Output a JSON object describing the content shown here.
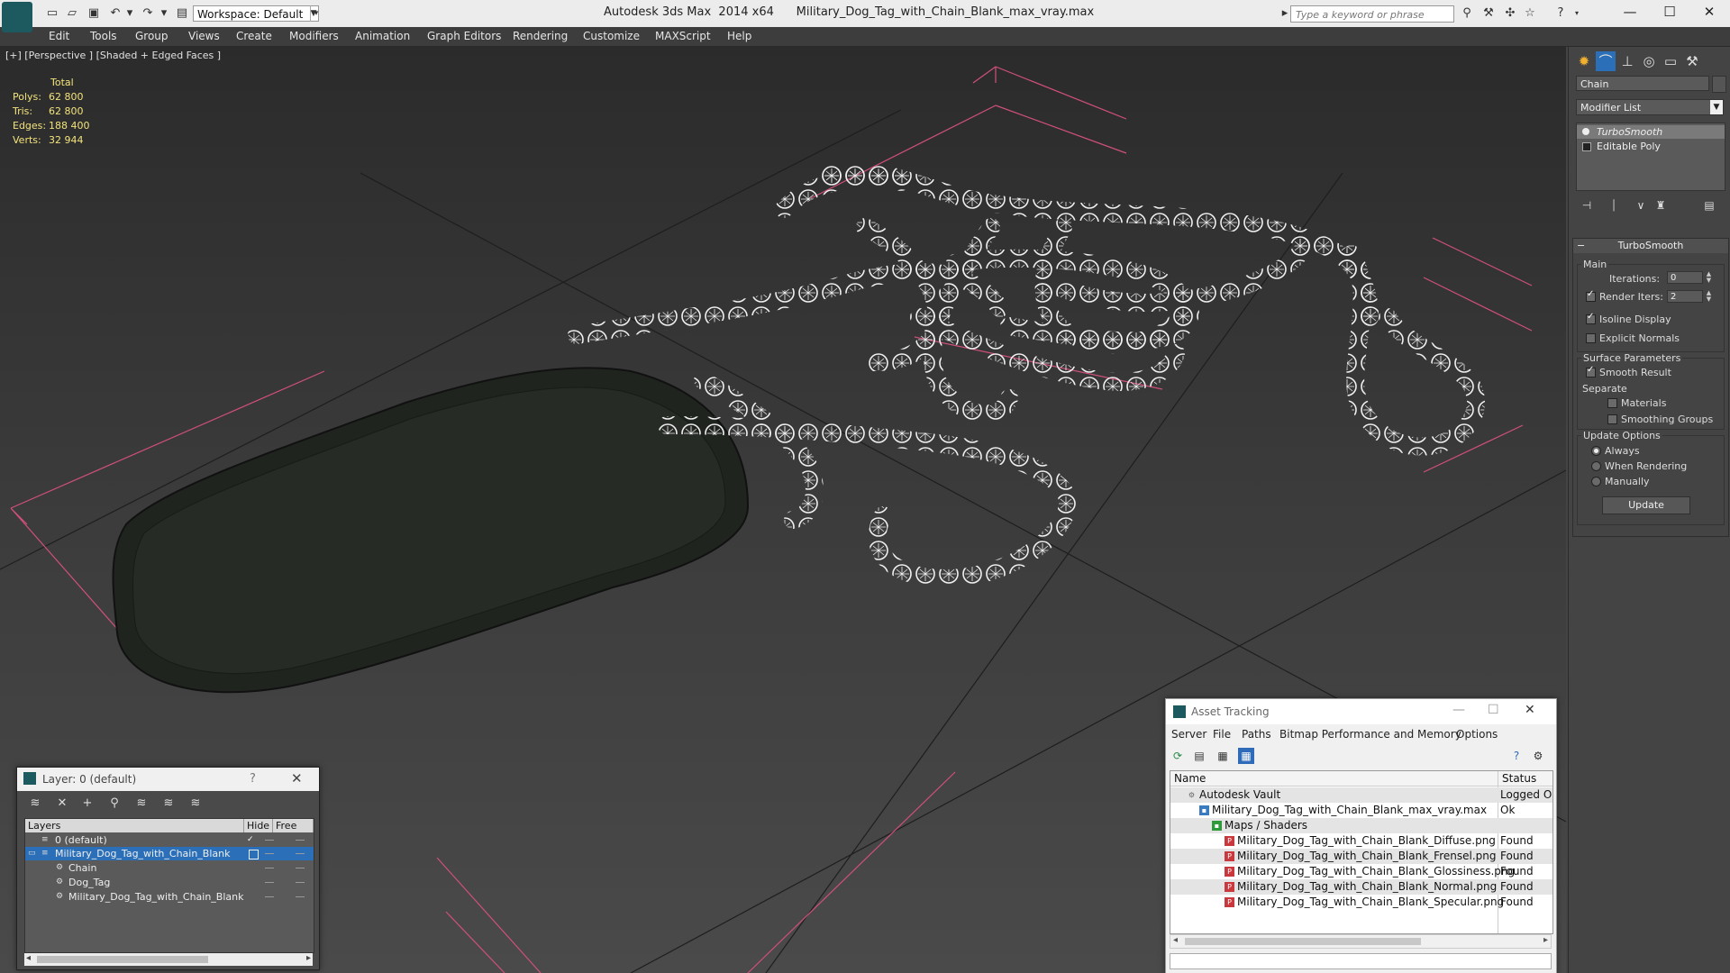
{
  "app": {
    "title": "Autodesk 3ds Max  2014 x64      Military_Dog_Tag_with_Chain_Blank_max_vray.max",
    "workspace": "Workspace: Default",
    "search_placeholder": "Type a keyword or phrase"
  },
  "menu": [
    "Edit",
    "Tools",
    "Group",
    "Views",
    "Create",
    "Modifiers",
    "Animation",
    "Graph Editors",
    "Rendering",
    "Customize",
    "MAXScript",
    "Help"
  ],
  "viewport": {
    "label": "[+] [Perspective ] [Shaded + Edged Faces ]",
    "stats": {
      "header": "Total",
      "rows": [
        {
          "k": "Polys:",
          "v": "62 800"
        },
        {
          "k": "Tris:",
          "v": "62 800"
        },
        {
          "k": "Edges:",
          "v": "188 400"
        },
        {
          "k": "Verts:",
          "v": "32 944"
        }
      ]
    }
  },
  "command_panel": {
    "object_name": "Chain",
    "modifier_list": "Modifier List",
    "stack": [
      "TurboSmooth",
      "Editable Poly"
    ],
    "rollout_title": "TurboSmooth",
    "main_group": "Main",
    "iterations_label": "Iterations:",
    "iterations_value": "0",
    "render_iters_label": "Render Iters:",
    "render_iters_value": "2",
    "isoline_label": "Isoline Display",
    "explicit_label": "Explicit Normals",
    "surface_group": "Surface Parameters",
    "smooth_result_label": "Smooth Result",
    "separate_label": "Separate",
    "materials_label": "Materials",
    "smoothing_groups_label": "Smoothing Groups",
    "update_group": "Update Options",
    "always_label": "Always",
    "when_rendering_label": "When Rendering",
    "manually_label": "Manually",
    "update_button": "Update"
  },
  "layer_window": {
    "title": "Layer: 0 (default)",
    "help": "?",
    "columns": [
      "Layers",
      "Hide",
      "Free"
    ],
    "rows": [
      {
        "name": "0 (default)",
        "indent": 0
      },
      {
        "name": "Military_Dog_Tag_with_Chain_Blank",
        "indent": 0,
        "selected": true
      },
      {
        "name": "Chain",
        "indent": 1
      },
      {
        "name": "Dog_Tag",
        "indent": 1
      },
      {
        "name": "Military_Dog_Tag_with_Chain_Blank",
        "indent": 1
      }
    ]
  },
  "asset_window": {
    "title": "Asset Tracking",
    "menu": [
      "Server",
      "File",
      "Paths",
      "Bitmap Performance and Memory",
      "Options"
    ],
    "columns": [
      "Name",
      "Status"
    ],
    "rows": [
      {
        "name": "Autodesk Vault",
        "status": "Logged Ou",
        "level": 0,
        "icon": "vault-icon"
      },
      {
        "name": "Military_Dog_Tag_with_Chain_Blank_max_vray.max",
        "status": "Ok",
        "level": 1,
        "icon": "max-file-icon"
      },
      {
        "name": "Maps / Shaders",
        "status": "",
        "level": 2,
        "icon": "maps-icon"
      },
      {
        "name": "Military_Dog_Tag_with_Chain_Blank_Diffuse.png",
        "status": "Found",
        "level": 3,
        "icon": "png-icon"
      },
      {
        "name": "Military_Dog_Tag_with_Chain_Blank_Frensel.png",
        "status": "Found",
        "level": 3,
        "icon": "png-icon"
      },
      {
        "name": "Military_Dog_Tag_with_Chain_Blank_Glossiness.png",
        "status": "Found",
        "level": 3,
        "icon": "png-icon"
      },
      {
        "name": "Military_Dog_Tag_with_Chain_Blank_Normal.png",
        "status": "Found",
        "level": 3,
        "icon": "png-icon"
      },
      {
        "name": "Military_Dog_Tag_with_Chain_Blank_Specular.png",
        "status": "Found",
        "level": 3,
        "icon": "png-icon"
      }
    ]
  },
  "colors": {
    "selection": "#2a6fb8",
    "stats_text": "#f3e37c",
    "bounding_box": "#d0507a"
  }
}
